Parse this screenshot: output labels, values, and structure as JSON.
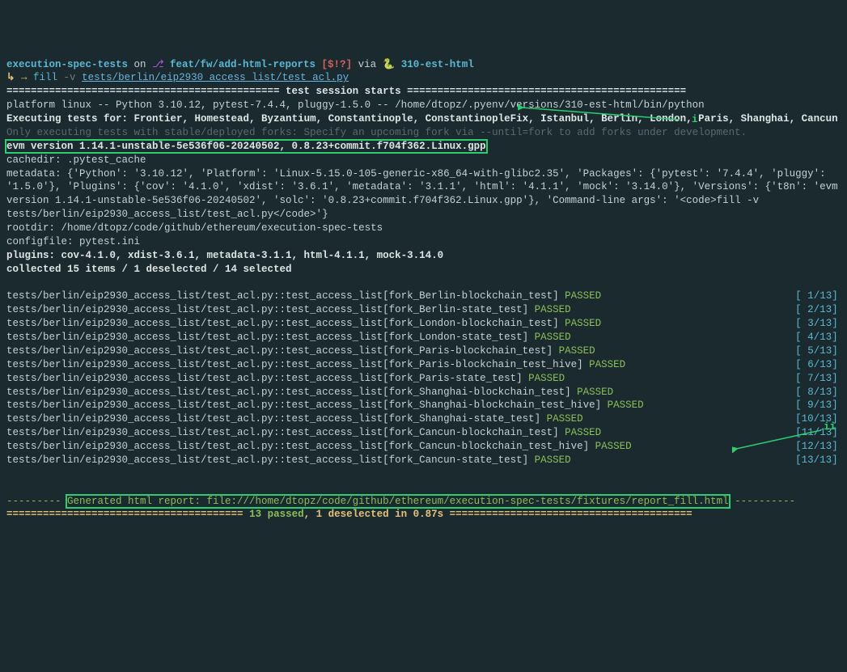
{
  "prompt": {
    "repo": "execution-spec-tests",
    "on": "on",
    "branch_icon": "⎇",
    "branch": "feat/fw/add-html-reports",
    "status": "[$!?]",
    "via": "via",
    "snake": "🐍",
    "env": "310-est-html",
    "arrow": "↳ →",
    "cmd": "fill",
    "flag": "-v",
    "arg": "tests/berlin/eip2930_access_list/test_acl.py"
  },
  "session": {
    "header_line": "============================================= test session starts ==============================================",
    "platform": "platform linux -- Python 3.10.12, pytest-7.4.4, pluggy-1.5.0 -- /home/dtopz/.pyenv/versions/310-est-html/bin/python",
    "executing_label": "Executing tests for: ",
    "executing_forks": "Frontier, Homestead, Byzantium, Constantinople, ConstantinopleFix, Istanbul, Berlin, London, Paris, Shanghai, Cancun",
    "only_executing": "Only executing tests with stable/deployed forks: Specify an upcoming fork via --until=fork to add forks under development.",
    "evm_version": "evm version 1.14.1-unstable-5e536f06-20240502, 0.8.23+commit.f704f362.Linux.gpp",
    "cachedir": "cachedir: .pytest_cache",
    "metadata": "metadata: {'Python': '3.10.12', 'Platform': 'Linux-5.15.0-105-generic-x86_64-with-glibc2.35', 'Packages': {'pytest': '7.4.4', 'pluggy': '1.5.0'}, 'Plugins': {'cov': '4.1.0', 'xdist': '3.6.1', 'metadata': '3.1.1', 'html': '4.1.1', 'mock': '3.14.0'}, 'Versions': {'t8n': 'evm version 1.14.1-unstable-5e536f06-20240502', 'solc': '0.8.23+commit.f704f362.Linux.gpp'}, 'Command-line args': '<code>fill -v tests/berlin/eip2930_access_list/test_acl.py</code>'}",
    "rootdir": "rootdir: /home/dtopz/code/github/ethereum/execution-spec-tests",
    "configfile": "configfile: pytest.ini",
    "plugins_line": "plugins: cov-4.1.0, xdist-3.6.1, metadata-3.1.1, html-4.1.1, mock-3.14.0",
    "collected": "collected 15 items / 1 deselected / 14 selected"
  },
  "tests": [
    {
      "name": "tests/berlin/eip2930_access_list/test_acl.py::test_access_list[fork_Berlin-blockchain_test]",
      "status": "PASSED",
      "counter": "[ 1/13]"
    },
    {
      "name": "tests/berlin/eip2930_access_list/test_acl.py::test_access_list[fork_Berlin-state_test]",
      "status": "PASSED",
      "counter": "[ 2/13]"
    },
    {
      "name": "tests/berlin/eip2930_access_list/test_acl.py::test_access_list[fork_London-blockchain_test]",
      "status": "PASSED",
      "counter": "[ 3/13]"
    },
    {
      "name": "tests/berlin/eip2930_access_list/test_acl.py::test_access_list[fork_London-state_test]",
      "status": "PASSED",
      "counter": "[ 4/13]"
    },
    {
      "name": "tests/berlin/eip2930_access_list/test_acl.py::test_access_list[fork_Paris-blockchain_test]",
      "status": "PASSED",
      "counter": "[ 5/13]"
    },
    {
      "name": "tests/berlin/eip2930_access_list/test_acl.py::test_access_list[fork_Paris-blockchain_test_hive]",
      "status": "PASSED",
      "counter": "[ 6/13]"
    },
    {
      "name": "tests/berlin/eip2930_access_list/test_acl.py::test_access_list[fork_Paris-state_test]",
      "status": "PASSED",
      "counter": "[ 7/13]"
    },
    {
      "name": "tests/berlin/eip2930_access_list/test_acl.py::test_access_list[fork_Shanghai-blockchain_test]",
      "status": "PASSED",
      "counter": "[ 8/13]"
    },
    {
      "name": "tests/berlin/eip2930_access_list/test_acl.py::test_access_list[fork_Shanghai-blockchain_test_hive]",
      "status": "PASSED",
      "counter": "[ 9/13]"
    },
    {
      "name": "tests/berlin/eip2930_access_list/test_acl.py::test_access_list[fork_Shanghai-state_test]",
      "status": "PASSED",
      "counter": "[10/13]"
    },
    {
      "name": "tests/berlin/eip2930_access_list/test_acl.py::test_access_list[fork_Cancun-blockchain_test]",
      "status": "PASSED",
      "counter": "[11/13]"
    },
    {
      "name": "tests/berlin/eip2930_access_list/test_acl.py::test_access_list[fork_Cancun-blockchain_test_hive]",
      "status": "PASSED",
      "counter": "[12/13]"
    },
    {
      "name": "tests/berlin/eip2930_access_list/test_acl.py::test_access_list[fork_Cancun-state_test]",
      "status": "PASSED",
      "counter": "[13/13]"
    }
  ],
  "report": {
    "dash_prefix": "--------- ",
    "text": "Generated html report: file:///home/dtopz/code/github/ethereum/execution-spec-tests/fixtures/report_fill.html",
    "dash_suffix": " ----------"
  },
  "summary": {
    "equals_prefix": "======================================= ",
    "passed": "13 passed",
    "sep": ", ",
    "deselected": "1 deselected",
    "time": " in 0.87s",
    "equals_suffix": " ========================================"
  },
  "annotations": {
    "i": "i",
    "ii": "ii"
  }
}
